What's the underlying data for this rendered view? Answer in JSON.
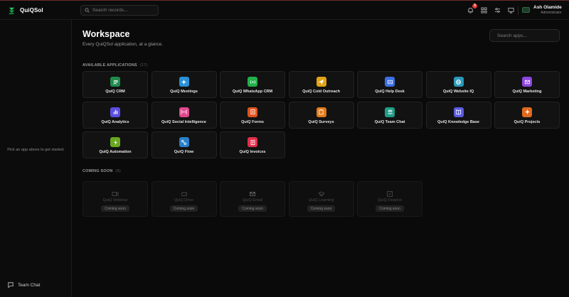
{
  "brand": {
    "name": "QuiQSol"
  },
  "topbar": {
    "search_placeholder": "Search records...",
    "notification_count": "3",
    "user_name": "Ash Olamide",
    "user_role": "Administrator"
  },
  "sidebar": {
    "hint": "Pick an app above to get started.",
    "team_chat_label": "Team Chat"
  },
  "workspace": {
    "title": "Workspace",
    "subtitle": "Every QuiQSol application, at a glance.",
    "search_placeholder": "Search apps..."
  },
  "available": {
    "heading": "AVAILABLE APPLICATIONS",
    "count": "(17)",
    "apps": [
      {
        "label": "QuiQ CRM",
        "color": "#1f8a4c",
        "icon": "users-icon"
      },
      {
        "label": "QuiQ Meetings",
        "color": "#2a8fd6",
        "icon": "sparkle-icon"
      },
      {
        "label": "QuiQ WhatsApp CRM",
        "color": "#22b04b",
        "icon": "broadcast-icon"
      },
      {
        "label": "QuiQ Cold Outreach",
        "color": "#e0a416",
        "icon": "send-icon"
      },
      {
        "label": "QuiQ Help Desk",
        "color": "#3b6fe6",
        "icon": "ticket-icon"
      },
      {
        "label": "QuiQ Website IQ",
        "color": "#2a98b8",
        "icon": "globe-icon"
      },
      {
        "label": "QuiQ Marketing",
        "color": "#8c46e0",
        "icon": "mail-icon"
      },
      {
        "label": "QuiQ Analytics",
        "color": "#5b4fe0",
        "icon": "bar-chart-icon"
      },
      {
        "label": "QuiQ Social Intelligence",
        "color": "#e0468c",
        "icon": "signal-icon"
      },
      {
        "label": "QuiQ Forms",
        "color": "#e0531f",
        "icon": "form-icon"
      },
      {
        "label": "QuiQ Surveys",
        "color": "#e07a16",
        "icon": "clipboard-icon"
      },
      {
        "label": "QuiQ Team Chat",
        "color": "#1f9c86",
        "icon": "team-icon"
      },
      {
        "label": "QuiQ Knowledge Base",
        "color": "#5b5be0",
        "icon": "book-icon"
      },
      {
        "label": "QuiQ Projects",
        "color": "#e06a1f",
        "icon": "sparkle-icon"
      },
      {
        "label": "QuiQ Automation",
        "color": "#6aa81f",
        "icon": "bolt-icon"
      },
      {
        "label": "QuiQ Flow",
        "color": "#2a7fc8",
        "icon": "flow-icon"
      },
      {
        "label": "QuiQ Invoices",
        "color": "#e02f4a",
        "icon": "invoice-icon"
      }
    ]
  },
  "coming_soon": {
    "heading": "COMING SOON",
    "count": "(5)",
    "pill_label": "Coming soon",
    "apps": [
      {
        "label": "QuiQ Webinar",
        "icon": "video-icon"
      },
      {
        "label": "QuiQ Drive",
        "icon": "drive-icon"
      },
      {
        "label": "QuiQ Email",
        "icon": "mail-icon"
      },
      {
        "label": "QuiQ Learning",
        "icon": "graduation-icon"
      },
      {
        "label": "QuiQ Finance",
        "icon": "finance-icon"
      }
    ]
  }
}
